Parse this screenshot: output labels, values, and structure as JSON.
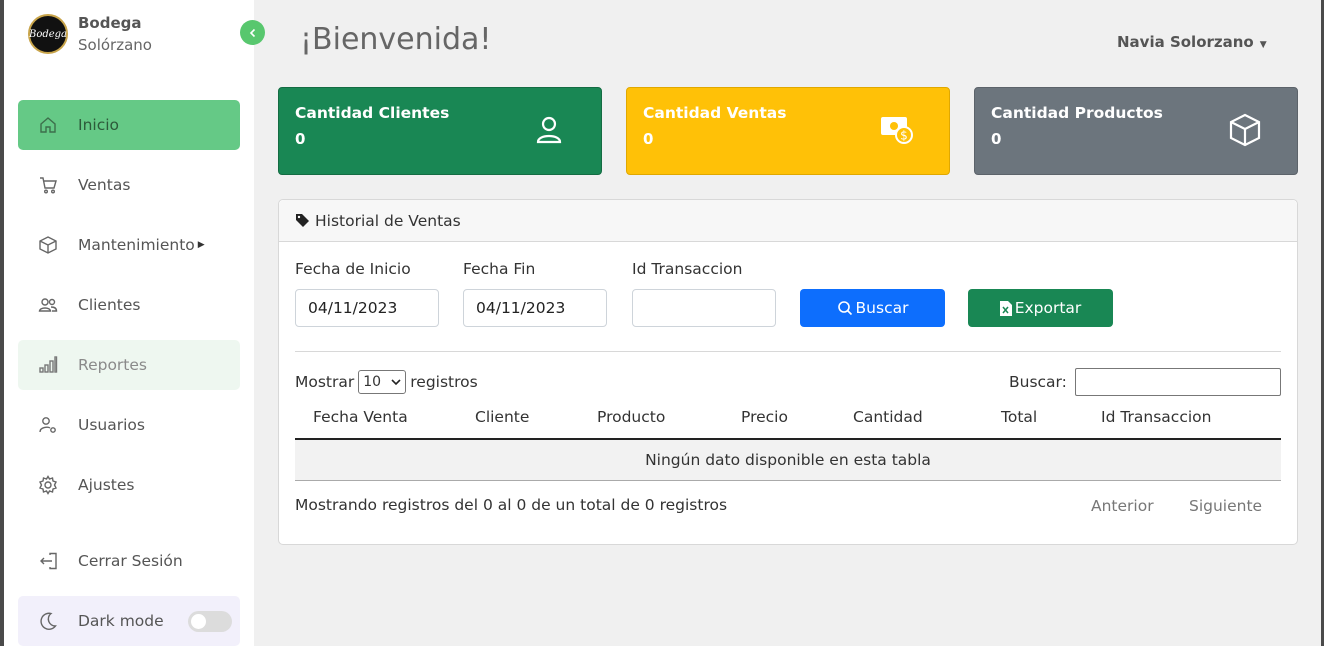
{
  "brand": {
    "line1": "Bodega",
    "line2": "Solórzano",
    "logo_text": "Bodega"
  },
  "sidebar": {
    "items": [
      {
        "label": "Inicio",
        "icon": "home-icon"
      },
      {
        "label": "Ventas",
        "icon": "cart-icon"
      },
      {
        "label": "Mantenimiento",
        "icon": "box-icon"
      },
      {
        "label": "Clientes",
        "icon": "users-icon"
      },
      {
        "label": "Reportes",
        "icon": "chart-icon"
      },
      {
        "label": "Usuarios",
        "icon": "user-gear-icon"
      },
      {
        "label": "Ajustes",
        "icon": "gear-icon"
      }
    ],
    "logout": "Cerrar Sesión",
    "dark_mode": "Dark mode"
  },
  "header": {
    "title": "¡Bienvenida!",
    "user": "Navia Solorzano"
  },
  "cards": [
    {
      "label": "Cantidad Clientes",
      "value": "0",
      "color": "#198754"
    },
    {
      "label": "Cantidad Ventas",
      "value": "0",
      "color": "#ffc107"
    },
    {
      "label": "Cantidad Productos",
      "value": "0",
      "color": "#6c757d"
    }
  ],
  "history": {
    "title": "Historial de Ventas",
    "start_label": "Fecha de Inicio",
    "start_value": "04/11/2023",
    "end_label": "Fecha Fin",
    "end_value": "04/11/2023",
    "txn_label": "Id Transaccion",
    "txn_value": "",
    "search_button": "Buscar",
    "export_button": "Exportar",
    "show_prefix": "Mostrar",
    "show_value": "10",
    "show_suffix": "registros",
    "search_label": "Buscar:",
    "columns": [
      "Fecha Venta",
      "Cliente",
      "Producto",
      "Precio",
      "Cantidad",
      "Total",
      "Id Transaccion"
    ],
    "empty": "Ningún dato disponible en esta tabla",
    "info": "Mostrando registros del 0 al 0 de un total de 0 registros",
    "prev": "Anterior",
    "next": "Siguiente"
  }
}
